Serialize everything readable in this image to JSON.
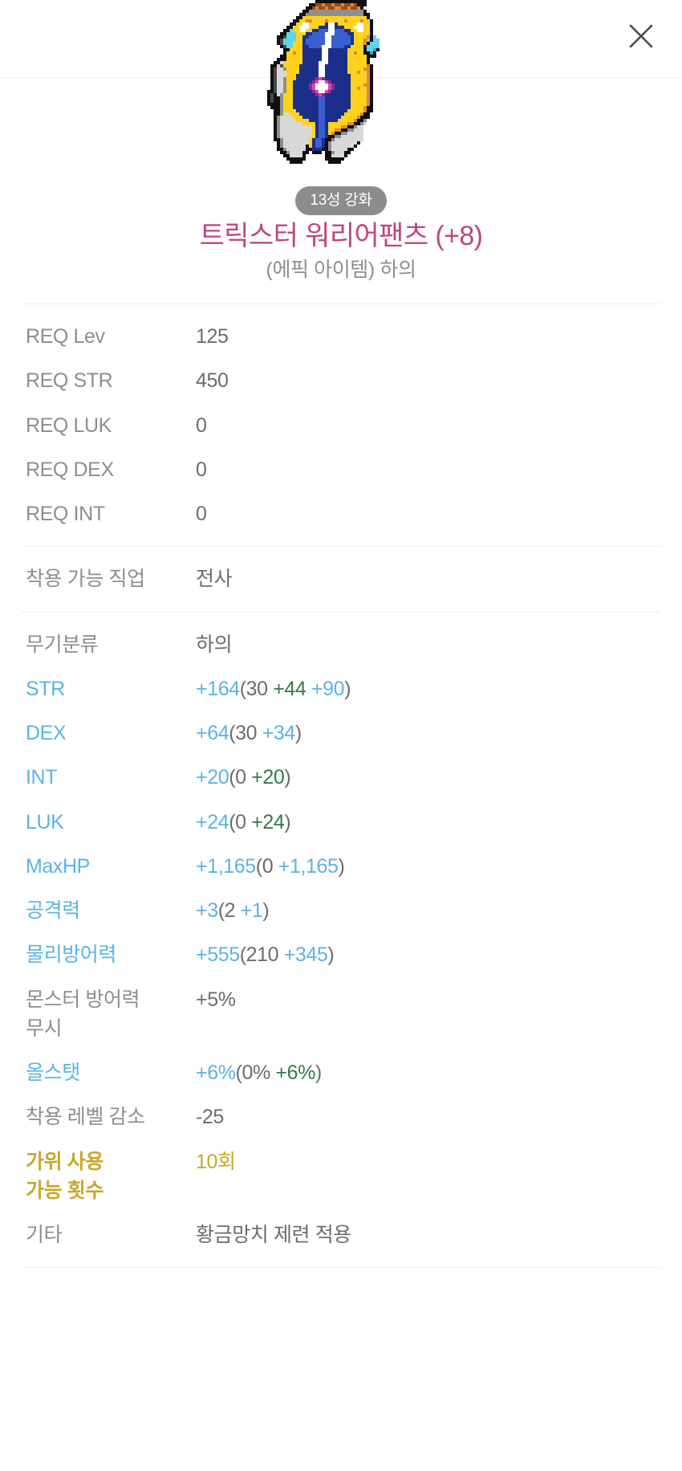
{
  "header": {
    "close_icon": "close-icon"
  },
  "item": {
    "icon_name": "trickster-warrior-pants-sprite",
    "badge": "13성 강화",
    "title": "트릭스터 워리어팬츠 (+8)",
    "subtitle": "(에픽 아이템) 하의",
    "title_color": "#c0467e",
    "badge_bg": "#8c8c8c"
  },
  "colors": {
    "label_gray": "#8e8e8e",
    "value_gray": "#6d6d6d",
    "blue": "#5bb3e4",
    "green": "#2f7a4a",
    "gold": "#c8a82a",
    "divider": "#efefef"
  },
  "requirements": [
    {
      "label": "REQ Lev",
      "value": "125"
    },
    {
      "label": "REQ STR",
      "value": "450"
    },
    {
      "label": "REQ LUK",
      "value": "0"
    },
    {
      "label": "REQ DEX",
      "value": "0"
    },
    {
      "label": "REQ INT",
      "value": "0"
    }
  ],
  "job": {
    "label": "착용 가능 직업",
    "value": "전사"
  },
  "details": [
    {
      "label": "무기분류",
      "label_style": "gray",
      "value_style": "gray",
      "parts": [
        {
          "text": "하의",
          "color": "gray"
        }
      ]
    },
    {
      "label": "STR",
      "label_style": "blue",
      "value_style": "blue",
      "parts": [
        {
          "text": "+164",
          "color": "blue"
        },
        {
          "text": "(30 ",
          "color": "gray"
        },
        {
          "text": "+44 ",
          "color": "green"
        },
        {
          "text": "+90",
          "color": "blue"
        },
        {
          "text": ")",
          "color": "gray"
        }
      ]
    },
    {
      "label": "DEX",
      "label_style": "blue",
      "value_style": "blue",
      "parts": [
        {
          "text": "+64",
          "color": "blue"
        },
        {
          "text": "(30 ",
          "color": "gray"
        },
        {
          "text": "+34",
          "color": "blue"
        },
        {
          "text": ")",
          "color": "gray"
        }
      ]
    },
    {
      "label": "INT",
      "label_style": "blue",
      "value_style": "blue",
      "parts": [
        {
          "text": "+20",
          "color": "blue"
        },
        {
          "text": "(0 ",
          "color": "gray"
        },
        {
          "text": "+20",
          "color": "green"
        },
        {
          "text": ")",
          "color": "gray"
        }
      ]
    },
    {
      "label": "LUK",
      "label_style": "blue",
      "value_style": "blue",
      "parts": [
        {
          "text": "+24",
          "color": "blue"
        },
        {
          "text": "(0 ",
          "color": "gray"
        },
        {
          "text": "+24",
          "color": "green"
        },
        {
          "text": ")",
          "color": "gray"
        }
      ]
    },
    {
      "label": "MaxHP",
      "label_style": "blue",
      "value_style": "blue",
      "parts": [
        {
          "text": "+1,165",
          "color": "blue"
        },
        {
          "text": "(0 ",
          "color": "gray"
        },
        {
          "text": "+1,165",
          "color": "blue"
        },
        {
          "text": ")",
          "color": "gray"
        }
      ]
    },
    {
      "label": "공격력",
      "label_style": "blue",
      "value_style": "blue",
      "parts": [
        {
          "text": "+3",
          "color": "blue"
        },
        {
          "text": "(2 ",
          "color": "gray"
        },
        {
          "text": "+1",
          "color": "blue"
        },
        {
          "text": ")",
          "color": "gray"
        }
      ]
    },
    {
      "label": "물리방어력",
      "label_style": "blue",
      "value_style": "blue",
      "parts": [
        {
          "text": "+555",
          "color": "blue"
        },
        {
          "text": "(210 ",
          "color": "gray"
        },
        {
          "text": "+345",
          "color": "blue"
        },
        {
          "text": ")",
          "color": "gray"
        }
      ]
    },
    {
      "label": "몬스터 방어력\n무시",
      "label_style": "gray",
      "value_style": "gray",
      "parts": [
        {
          "text": "+5%",
          "color": "gray"
        }
      ]
    },
    {
      "label": "올스탯",
      "label_style": "blue",
      "value_style": "blue",
      "parts": [
        {
          "text": "+6%",
          "color": "blue"
        },
        {
          "text": "(0% ",
          "color": "gray"
        },
        {
          "text": "+6%",
          "color": "green"
        },
        {
          "text": ")",
          "color": "gray"
        }
      ]
    },
    {
      "label": "착용 레벨 감소",
      "label_style": "gray",
      "value_style": "gray",
      "parts": [
        {
          "text": "-25",
          "color": "gray"
        }
      ]
    },
    {
      "label": "가위 사용\n가능 횟수",
      "label_style": "gold",
      "value_style": "gold",
      "parts": [
        {
          "text": "10회",
          "color": "gold"
        }
      ]
    },
    {
      "label": "기타",
      "label_style": "gray",
      "value_style": "gray",
      "parts": [
        {
          "text": "황금망치 제련 적용",
          "color": "gray"
        }
      ]
    }
  ]
}
